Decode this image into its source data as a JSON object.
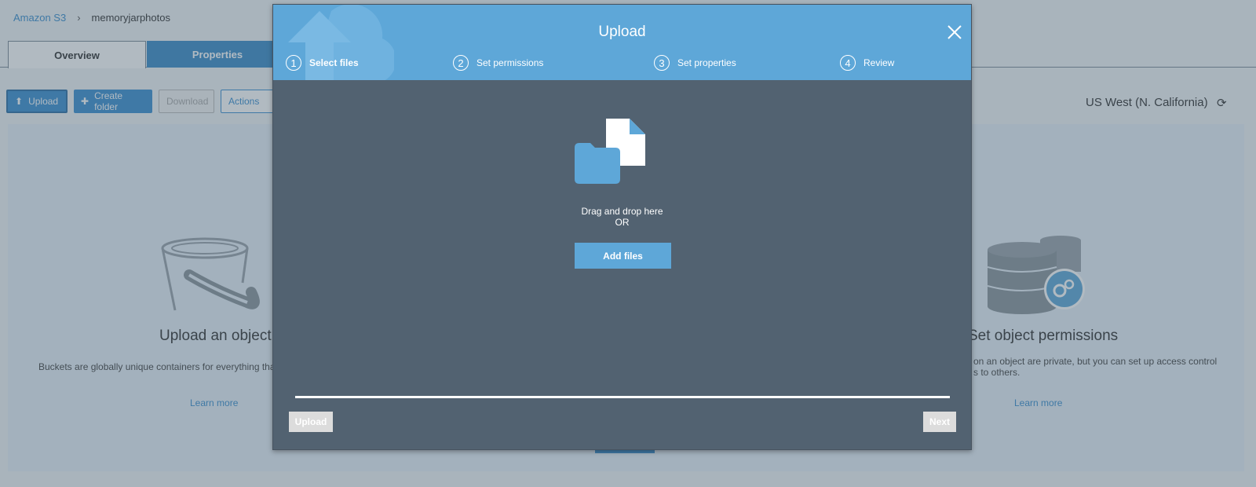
{
  "breadcrumb": {
    "root": "Amazon S3",
    "separator": "›",
    "bucket": "memoryjarphotos"
  },
  "tabs": {
    "overview": "Overview",
    "properties": "Properties"
  },
  "toolbar": {
    "upload_label": "Upload",
    "create_folder_label": "Create folder",
    "download_label": "Download",
    "actions_label": "Actions"
  },
  "region": {
    "label": "US West (N. California)"
  },
  "cards": {
    "upload": {
      "title": "Upload an object",
      "description": "Buckets are globally unique containers for everything that y",
      "link": "Learn more"
    },
    "permissions": {
      "title": "Set object permissions",
      "description_line1": "on an object are private, but you can set up access control",
      "description_line2": "s to others.",
      "link": "Learn more"
    }
  },
  "modal": {
    "title": "Upload",
    "steps": [
      {
        "number": "1",
        "label": "Select files",
        "active": true
      },
      {
        "number": "2",
        "label": "Set permissions",
        "active": false
      },
      {
        "number": "3",
        "label": "Set properties",
        "active": false
      },
      {
        "number": "4",
        "label": "Review",
        "active": false
      }
    ],
    "drop_text": "Drag and drop here",
    "or_text": "OR",
    "add_files_label": "Add files",
    "upload_label": "Upload",
    "next_label": "Next"
  },
  "colors": {
    "accent": "#5ea7d8",
    "modal_body": "#526271",
    "link": "#3b8fcf"
  }
}
